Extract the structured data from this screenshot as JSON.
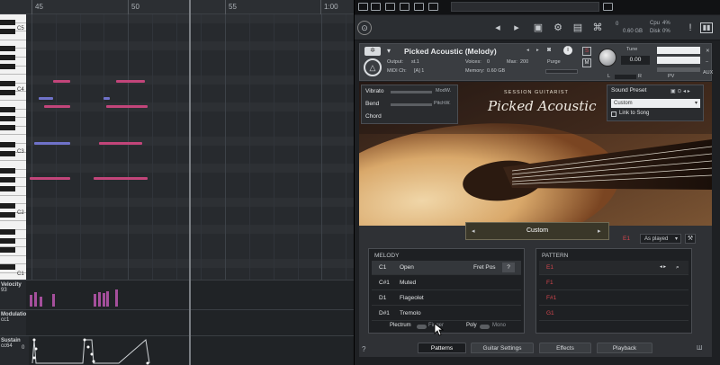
{
  "piano_roll": {
    "bars": [
      "45",
      "50",
      "55",
      "1:00"
    ],
    "octave_labels": [
      "C5",
      "C4",
      "C3",
      "C2",
      "C1"
    ],
    "lanes": {
      "velocity": {
        "label": "Velocity",
        "value": "93"
      },
      "modulation": {
        "label": "Modulatio",
        "value": "cc1"
      },
      "sustain": {
        "label": "Sustain",
        "value": "cc64",
        "value2": "0"
      }
    }
  },
  "kontakt": {
    "cpu_label": "Cpu",
    "cpu_value": "4%",
    "disk_label": "Disk",
    "disk_value": "0%",
    "mem_readout": "0.60 GB",
    "instrument": {
      "title": "Picked Acoustic (Melody)",
      "output_label": "Output:",
      "output_value": "st.1",
      "voices_label": "Voices:",
      "voices_value": "0",
      "max_label": "Max:",
      "max_value": "200",
      "purge_label": "Purge",
      "midi_label": "MIDI Ch:",
      "midi_value": "[A] 1",
      "memory_label": "Memory:",
      "memory_value": "0.60 GB",
      "tune_label": "Tune",
      "tune_value": "0.00",
      "s_label": "S",
      "m_label": "M",
      "l_label": "L",
      "r_label": "R",
      "aux_label": "AUX",
      "pv_label": "PV"
    },
    "art": {
      "brand_top": "SESSION GUITARIST",
      "brand_name": "Picked Acoustic",
      "vibrato_label": "Vibrato",
      "vibrato_mod": "ModW.",
      "bend_label": "Bend",
      "bend_mod": "PitchW.",
      "chord_label": "Chord",
      "sound_preset_label": "Sound Preset",
      "sound_preset_value": "Custom",
      "link_to_song": "Link to Song"
    },
    "pattern_bar": {
      "value": "Custom",
      "key": "E1",
      "mode": "As played"
    },
    "melody": {
      "header": "MELODY",
      "fret_pos_label": "Fret Pos",
      "fret_pos_value": "?",
      "rows": [
        {
          "key": "C1",
          "name": "Open"
        },
        {
          "key": "C#1",
          "name": "Muted"
        },
        {
          "key": "D1",
          "name": "Flageolet"
        },
        {
          "key": "D#1",
          "name": "Tremolo"
        }
      ],
      "plectrum_label": "Plectrum",
      "finger_label": "Finger",
      "poly_label": "Poly",
      "mono_label": "Mono"
    },
    "pattern": {
      "header": "PATTERN",
      "rows": [
        "E1",
        "F1",
        "F#1",
        "G1"
      ]
    },
    "tabs": [
      "Patterns",
      "Guitar Settings",
      "Effects",
      "Playback"
    ],
    "help_label": "?"
  },
  "colors": {
    "note_pink": "#c2457a",
    "note_blue": "#6f72c9",
    "accent_red": "#d2454d"
  }
}
